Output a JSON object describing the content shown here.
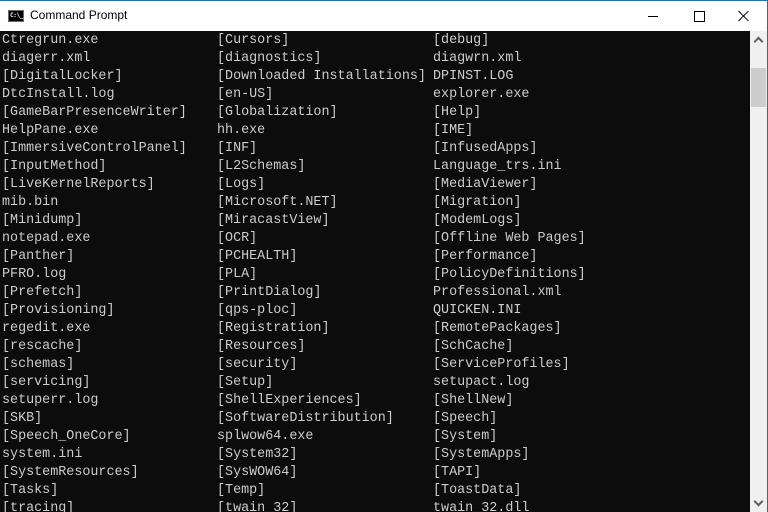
{
  "window": {
    "title": "Command Prompt",
    "app_icon": "command-prompt-icon",
    "app_icon_text": "C:\\_",
    "controls": [
      "minimize-icon",
      "maximize-icon",
      "close-icon"
    ],
    "accent_color": "#1f6fb2"
  },
  "console": {
    "background": "#0c0c0c",
    "foreground": "#cccccc",
    "rows": [
      [
        "Ctregrun.exe",
        "[Cursors]",
        "[debug]"
      ],
      [
        "diagerr.xml",
        "[diagnostics]",
        "diagwrn.xml"
      ],
      [
        "[DigitalLocker]",
        "[Downloaded Installations]",
        "DPINST.LOG"
      ],
      [
        "DtcInstall.log",
        "[en-US]",
        "explorer.exe"
      ],
      [
        "[GameBarPresenceWriter]",
        "[Globalization]",
        "[Help]"
      ],
      [
        "HelpPane.exe",
        "hh.exe",
        "[IME]"
      ],
      [
        "[ImmersiveControlPanel]",
        "[INF]",
        "[InfusedApps]"
      ],
      [
        "[InputMethod]",
        "[L2Schemas]",
        "Language_trs.ini"
      ],
      [
        "[LiveKernelReports]",
        "[Logs]",
        "[MediaViewer]"
      ],
      [
        "mib.bin",
        "[Microsoft.NET]",
        "[Migration]"
      ],
      [
        "[Minidump]",
        "[MiracastView]",
        "[ModemLogs]"
      ],
      [
        "notepad.exe",
        "[OCR]",
        "[Offline Web Pages]"
      ],
      [
        "[Panther]",
        "[PCHEALTH]",
        "[Performance]"
      ],
      [
        "PFRO.log",
        "[PLA]",
        "[PolicyDefinitions]"
      ],
      [
        "[Prefetch]",
        "[PrintDialog]",
        "Professional.xml"
      ],
      [
        "[Provisioning]",
        "[qps-ploc]",
        "QUICKEN.INI"
      ],
      [
        "regedit.exe",
        "[Registration]",
        "[RemotePackages]"
      ],
      [
        "[rescache]",
        "[Resources]",
        "[SchCache]"
      ],
      [
        "[schemas]",
        "[security]",
        "[ServiceProfiles]"
      ],
      [
        "[servicing]",
        "[Setup]",
        "setupact.log"
      ],
      [
        "setuperr.log",
        "[ShellExperiences]",
        "[ShellNew]"
      ],
      [
        "[SKB]",
        "[SoftwareDistribution]",
        "[Speech]"
      ],
      [
        "[Speech_OneCore]",
        "splwow64.exe",
        "[System]"
      ],
      [
        "system.ini",
        "[System32]",
        "[SystemApps]"
      ],
      [
        "[SystemResources]",
        "[SysWOW64]",
        "[TAPI]"
      ],
      [
        "[Tasks]",
        "[Temp]",
        "[ToastData]"
      ],
      [
        "[tracing]",
        "[twain_32]",
        "twain_32.dll"
      ]
    ]
  },
  "scrollbar": {
    "up_icon": "chevron-up-icon",
    "down_icon": "chevron-down-icon",
    "position_fraction": 0.05
  }
}
